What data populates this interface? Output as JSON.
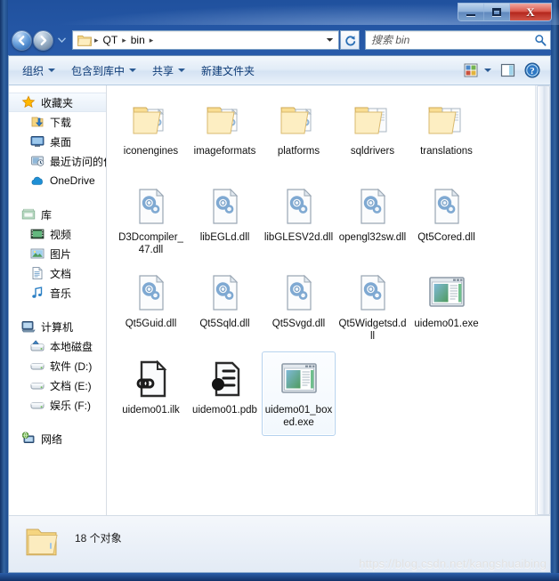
{
  "window": {
    "title": "",
    "buttons": {
      "minimize": "–",
      "maximize": "□",
      "close": "✕"
    }
  },
  "nav": {
    "back_icon": "back-arrow-icon",
    "forward_icon": "forward-arrow-icon",
    "recent_icon": "recent-pages-dropdown-icon",
    "refresh_icon": "refresh-icon",
    "breadcrumb": {
      "folder_icon": "folder-icon",
      "items": [
        "QT",
        "bin"
      ],
      "separator": "▸"
    }
  },
  "search": {
    "placeholder": "搜索 bin",
    "value": "",
    "icon": "search-icon"
  },
  "toolbar": {
    "organize": "组织",
    "include_in_library": "包含到库中",
    "share": "共享",
    "new_folder": "新建文件夹",
    "view_icon": "view-options-icon",
    "preview_pane_icon": "preview-pane-icon",
    "help_icon": "help-icon"
  },
  "sidebar": {
    "groups": [
      {
        "header": {
          "label": "收藏夹",
          "icon": "star-icon",
          "selected": true
        },
        "items": [
          {
            "label": "下载",
            "icon": "downloads-icon"
          },
          {
            "label": "桌面",
            "icon": "desktop-icon"
          },
          {
            "label": "最近访问的位置",
            "icon": "recent-places-icon"
          },
          {
            "label": "OneDrive",
            "icon": "onedrive-icon"
          }
        ]
      },
      {
        "header": {
          "label": "库",
          "icon": "library-icon",
          "selected": false
        },
        "items": [
          {
            "label": "视频",
            "icon": "videos-icon"
          },
          {
            "label": "图片",
            "icon": "pictures-icon"
          },
          {
            "label": "文档",
            "icon": "documents-icon"
          },
          {
            "label": "音乐",
            "icon": "music-icon"
          }
        ]
      },
      {
        "header": {
          "label": "计算机",
          "icon": "computer-icon",
          "selected": false
        },
        "items": [
          {
            "label": "本地磁盘",
            "icon": "system-drive-icon"
          },
          {
            "label": "软件 (D:)",
            "icon": "drive-icon"
          },
          {
            "label": "文档 (E:)",
            "icon": "drive-icon"
          },
          {
            "label": "娱乐 (F:)",
            "icon": "drive-icon"
          }
        ]
      },
      {
        "header": {
          "label": "网络",
          "icon": "network-icon",
          "selected": false
        },
        "items": []
      }
    ]
  },
  "files": [
    {
      "name": "iconengines",
      "type": "folder-gear",
      "selected": false
    },
    {
      "name": "imageformats",
      "type": "folder-gear",
      "selected": false
    },
    {
      "name": "platforms",
      "type": "folder-gear",
      "selected": false
    },
    {
      "name": "sqldrivers",
      "type": "folder-pages",
      "selected": false
    },
    {
      "name": "translations",
      "type": "folder-pages",
      "selected": false
    },
    {
      "name": "D3Dcompiler_47.dll",
      "type": "dll",
      "selected": false
    },
    {
      "name": "libEGLd.dll",
      "type": "dll",
      "selected": false
    },
    {
      "name": "libGLESV2d.dll",
      "type": "dll",
      "selected": false
    },
    {
      "name": "opengl32sw.dll",
      "type": "dll",
      "selected": false
    },
    {
      "name": "Qt5Cored.dll",
      "type": "dll",
      "selected": false
    },
    {
      "name": "Qt5Guid.dll",
      "type": "dll",
      "selected": false
    },
    {
      "name": "Qt5Sqld.dll",
      "type": "dll",
      "selected": false
    },
    {
      "name": "Qt5Svgd.dll",
      "type": "dll",
      "selected": false
    },
    {
      "name": "Qt5Widgetsd.dll",
      "type": "dll",
      "selected": false
    },
    {
      "name": "uidemo01.exe",
      "type": "app",
      "selected": false
    },
    {
      "name": "uidemo01.ilk",
      "type": "ilk",
      "selected": false
    },
    {
      "name": "uidemo01.pdb",
      "type": "pdb",
      "selected": false
    },
    {
      "name": "uidemo01_boxed.exe",
      "type": "app",
      "selected": true
    }
  ],
  "status": {
    "count_text": "18 个对象",
    "folder_icon": "folder-icon"
  },
  "watermark": "https://blog.csdn.net/kangshuaibing",
  "colors": {
    "frame": "#1f4f9c",
    "close_button": "#b3251b",
    "selection_border": "#b5d2ee",
    "folder_yellow": "#fbe08a",
    "accent_blue": "#0c3a76"
  }
}
